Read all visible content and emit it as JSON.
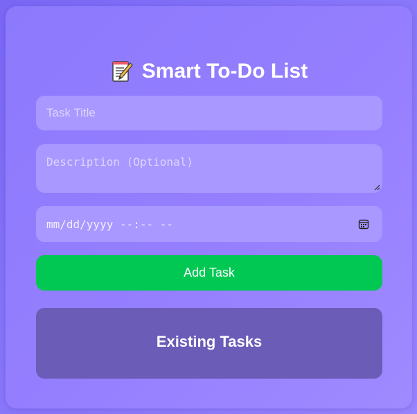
{
  "app": {
    "title": "Smart To-Do List",
    "title_icon": "memo-icon"
  },
  "form": {
    "task_title_placeholder": "Task Title",
    "description_placeholder": "Description (Optional)",
    "datetime_placeholder": "mm/dd/yyyy --:-- --",
    "datetime_icon": "calendar-icon",
    "add_button_label": "Add Task"
  },
  "tasks": {
    "heading": "Existing Tasks"
  },
  "colors": {
    "background": "#8a78fb",
    "field_background": "#a898ff",
    "add_button": "#00c853",
    "tasks_panel": "#6b5cb8",
    "text": "#ffffff"
  }
}
